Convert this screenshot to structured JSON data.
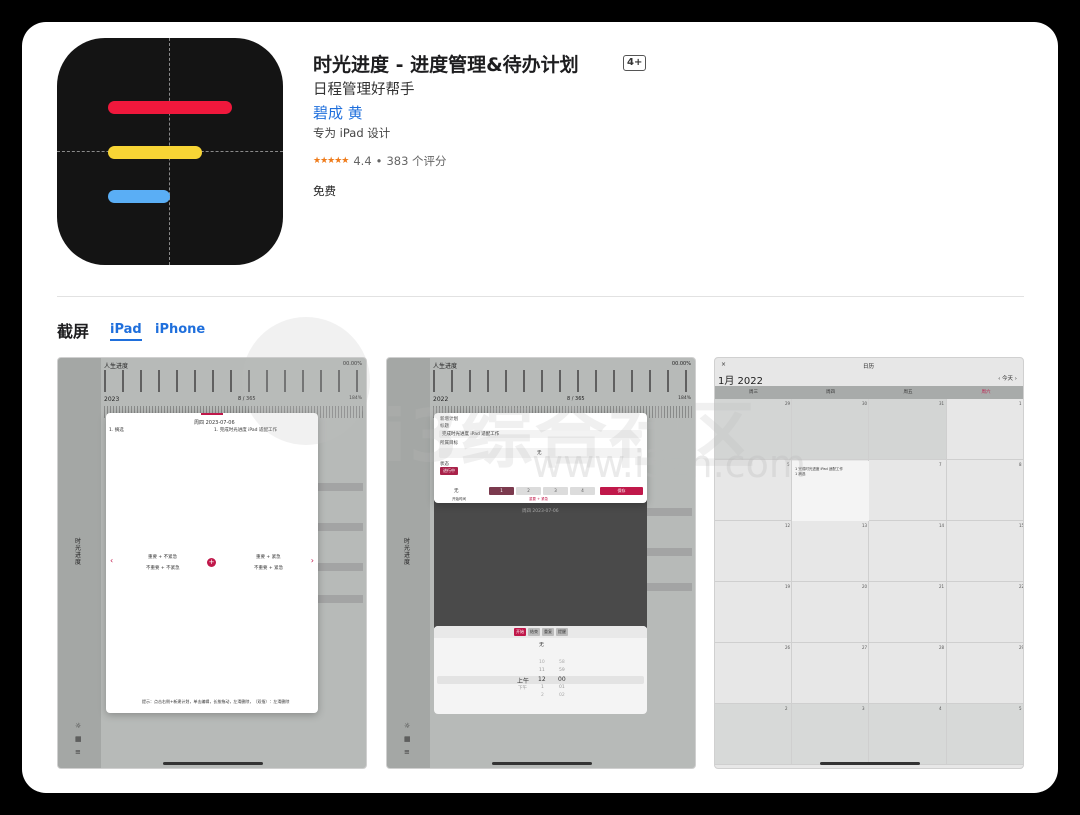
{
  "app": {
    "title": "时光进度 - 进度管理&待办计划",
    "age_badge": "4+",
    "subtitle": "日程管理好帮手",
    "developer": "碧成 黄",
    "designed_for": "专为 iPad 设计",
    "stars": "★★★★★",
    "rating_value": "4.4",
    "rating_count": "383 个评分",
    "price": "免费"
  },
  "icon": {
    "bar_colors": [
      "#f0183c",
      "#f8d535",
      "#5aaef5"
    ]
  },
  "screenshots": {
    "heading": "截屏",
    "tabs": [
      "iPad",
      "iPhone"
    ],
    "selected_tab": "iPad"
  },
  "watermark": {
    "text": "i3综合社区",
    "url": "www.i3zh.com"
  },
  "shot1": {
    "header": "人生进度",
    "percent": "00.00%",
    "year": "2023",
    "days": "8 / 365",
    "day_percent": "184%",
    "modal_title": "周四 2023-07-06",
    "task": "1. 完成时光进度 iPad 适配工作",
    "plan_label": "1. 摘选",
    "sidebar_label": "时光进度",
    "quad_tl_1": "重要 + 不紧急",
    "quad_tl_2": "不重要 + 不紧急",
    "quad_tr_1": "重要 + 紧急",
    "quad_tr_2": "不重要 + 紧急",
    "hint": "提示：点击右侧+新建计划，单击编辑，长按拖动，左滑删除，（双指）：左滑删除"
  },
  "shot2": {
    "header": "人生进度",
    "percent": "00.00%",
    "year": "2022",
    "days": "8 / 365",
    "day_percent": "184%",
    "form_title": "新增计划",
    "field_title_label": "标题",
    "field_title_value": "完成时光进度 iPad 适配工作",
    "field_goal_label": "所属目标",
    "field_goal_value": "无",
    "status_label": "状态",
    "status_value": "进行中",
    "none_label": "无",
    "priority": [
      "1",
      "2",
      "3",
      "4"
    ],
    "save_label": "保存",
    "start_label": "开始时间",
    "important_label": "重要 + 紧急",
    "date_label": "周四 2023-07-06",
    "picker_tabs": [
      "开始",
      "结束",
      "重复",
      "提醒"
    ],
    "picker_title": "无",
    "picker_col1": [
      "上午",
      "下午"
    ],
    "picker_col2": [
      "10",
      "11",
      "12",
      "1",
      "2"
    ],
    "picker_col3": [
      "58",
      "59",
      "00",
      "01",
      "02"
    ],
    "sidebar_label": "时光进度"
  },
  "shot3": {
    "close": "×",
    "title": "日历",
    "month": "1月 2022",
    "nav": "‹ 今天 ›",
    "weekdays": [
      "周三",
      "周四",
      "周五",
      "周六"
    ],
    "event": "1 完成时光进度 iPad 适配工作",
    "event_sub": "1 摘选",
    "row_nums": [
      [
        "29",
        "30",
        "31",
        "1"
      ],
      [
        "5",
        "6",
        "7",
        "8"
      ],
      [
        "12",
        "13",
        "14",
        "15"
      ],
      [
        "19",
        "20",
        "21",
        "22"
      ],
      [
        "26",
        "27",
        "28",
        "29"
      ],
      [
        "2",
        "3",
        "4",
        "5"
      ]
    ]
  }
}
